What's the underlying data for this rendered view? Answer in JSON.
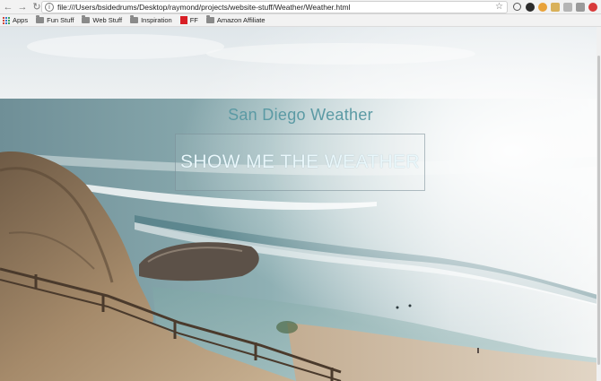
{
  "browser": {
    "url": "file:///Users/bsidedrums/Desktop/raymond/projects/website-stuff/Weather/Weather.html",
    "bookmarks": [
      "Apps",
      "Fun Stuff",
      "Web Stuff",
      "Inspiration",
      "FF",
      "Amazon Affiliate"
    ]
  },
  "page": {
    "title": "San Diego Weather",
    "button_label": "SHOW ME THE WEATHER"
  }
}
